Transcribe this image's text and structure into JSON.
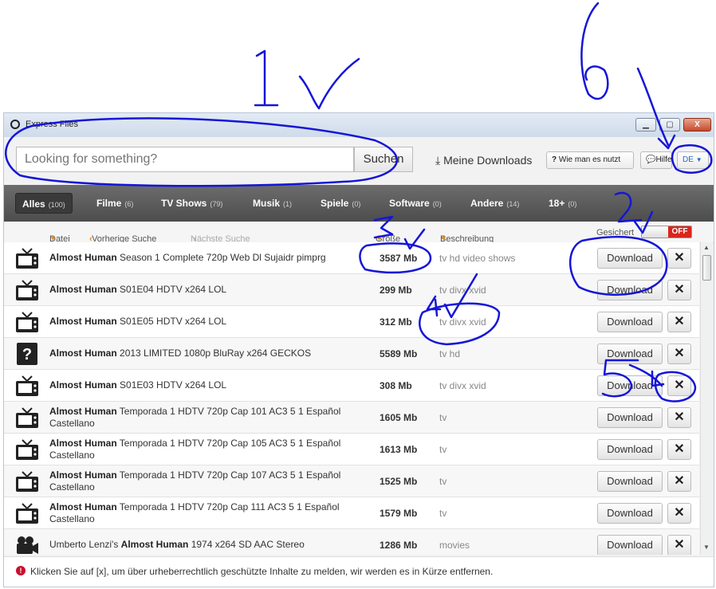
{
  "window": {
    "title": "Express Files",
    "controls": {
      "minimize": "▁",
      "maximize": "▢",
      "close": "X"
    }
  },
  "search": {
    "placeholder": "Looking for something?",
    "button": "Suchen",
    "my_downloads": "Meine Downloads",
    "how_to": "Wie man es nutzt",
    "help": "Hilfe",
    "language": "DE"
  },
  "tabs": [
    {
      "label": "Alles",
      "count": "(100)"
    },
    {
      "label": "Filme",
      "count": "(6)"
    },
    {
      "label": "TV Shows",
      "count": "(79)"
    },
    {
      "label": "Musik",
      "count": "(1)"
    },
    {
      "label": "Spiele",
      "count": "(0)"
    },
    {
      "label": "Software",
      "count": "(0)"
    },
    {
      "label": "Andere",
      "count": "(14)"
    },
    {
      "label": "18+",
      "count": "(0)"
    }
  ],
  "columns": {
    "file": "Datei",
    "prev_search": "Vorherige Suche",
    "next_search": "Nächste Suche",
    "size": "Größe",
    "description": "Beschreibung",
    "secured": "Gesichert",
    "toggle": "OFF"
  },
  "rows": [
    {
      "icon": "tv-icon",
      "bold": "Almost Human",
      "pre": "",
      "rest": " Season 1 Complete 720p Web Dl Sujaidr pimprg",
      "size": "3587 Mb",
      "desc": "tv hd video shows"
    },
    {
      "icon": "tv-icon",
      "bold": "Almost Human",
      "pre": "",
      "rest": " S01E04 HDTV x264 LOL",
      "size": "299 Mb",
      "desc": "tv divx xvid"
    },
    {
      "icon": "tv-icon",
      "bold": "Almost Human",
      "pre": "",
      "rest": " S01E05 HDTV x264 LOL",
      "size": "312 Mb",
      "desc": "tv divx xvid"
    },
    {
      "icon": "question-icon",
      "bold": "Almost Human",
      "pre": "",
      "rest": " 2013 LIMITED 1080p BluRay x264 GECKOS",
      "size": "5589 Mb",
      "desc": "tv hd"
    },
    {
      "icon": "tv-icon",
      "bold": "Almost Human",
      "pre": "",
      "rest": " S01E03 HDTV x264 LOL",
      "size": "308 Mb",
      "desc": "tv divx xvid"
    },
    {
      "icon": "tv-icon",
      "bold": "Almost Human",
      "pre": "",
      "rest": " Temporada 1 HDTV 720p Cap 101 AC3 5 1 Español Castellano",
      "size": "1605 Mb",
      "desc": "tv"
    },
    {
      "icon": "tv-icon",
      "bold": "Almost Human",
      "pre": "",
      "rest": " Temporada 1 HDTV 720p Cap 105 AC3 5 1 Español Castellano",
      "size": "1613 Mb",
      "desc": "tv"
    },
    {
      "icon": "tv-icon",
      "bold": "Almost Human",
      "pre": "",
      "rest": " Temporada 1 HDTV 720p Cap 107 AC3 5 1 Español Castellano",
      "size": "1525 Mb",
      "desc": "tv"
    },
    {
      "icon": "tv-icon",
      "bold": "Almost Human",
      "pre": "",
      "rest": " Temporada 1 HDTV 720p Cap 111 AC3 5 1 Español Castellano",
      "size": "1579 Mb",
      "desc": "tv"
    },
    {
      "icon": "camera-icon",
      "bold": "Almost Human",
      "pre": "Umberto Lenzi's ",
      "rest": " 1974 x264 SD AAC Stereo",
      "size": "1286 Mb",
      "desc": "movies"
    }
  ],
  "row_button": "Download",
  "row_report": "✕",
  "footer": {
    "message": "Klicken Sie auf [x], um über urheberrechtlich geschützte Inhalte zu melden, wir werden es in Kürze entfernen."
  },
  "annotations": [
    "1",
    "2",
    "3",
    "4",
    "5",
    "6"
  ],
  "colors": {
    "annotation_ink": "#1515d8",
    "category_bar": "#5a5a5a",
    "toggle_off": "#d9251c",
    "sort_arrow": "#f08a00"
  }
}
